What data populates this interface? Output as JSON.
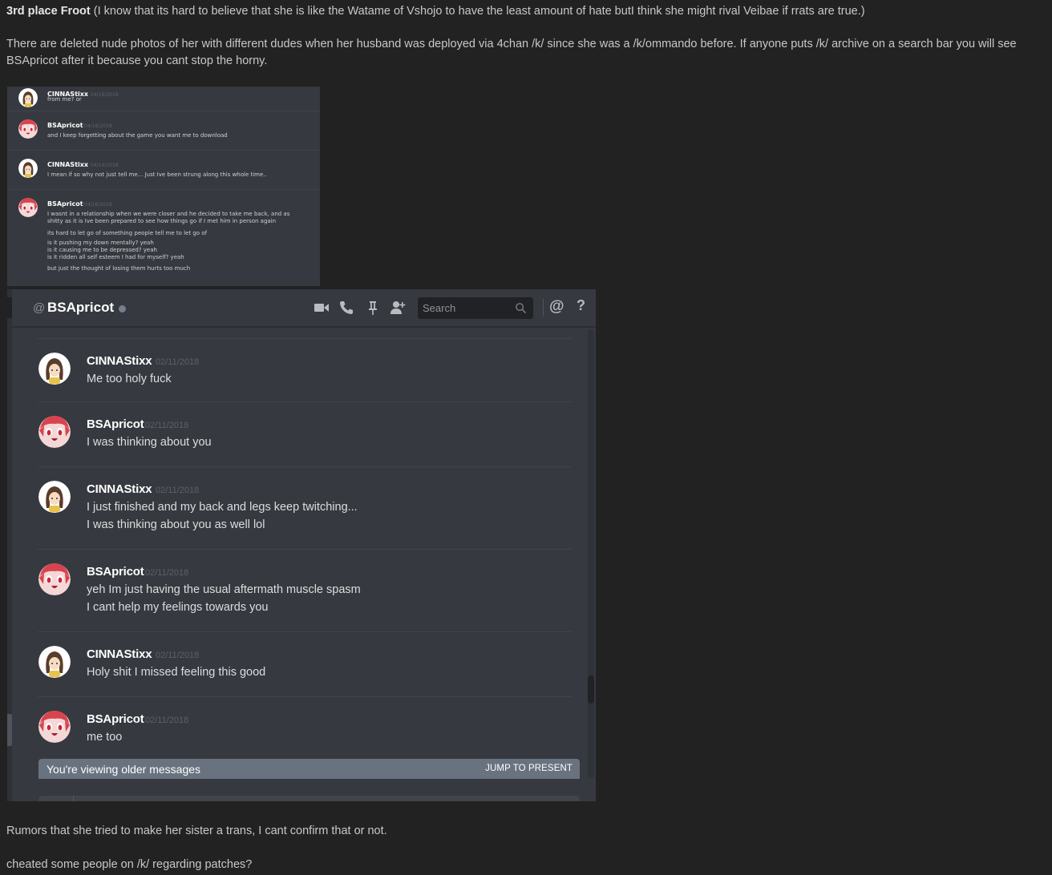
{
  "post": {
    "heading_bold": "3rd place Froot",
    "heading_rest": " (I know that its hard to believe that she is like the Watame of Vshojo to have the least amount of hate butI think she might rival Veibae if rrats are true.)",
    "para1_line1": "There are deleted nude photos of her with different dudes when her husband was deployed via 4chan /k/ since she was a /k/ommando before. If anyone puts /k/ archive on a search bar you will see",
    "para1_line2": "BSApricot after it because you cant stop the horny.",
    "para2": "Rumors that she tried to make her sister a trans, I cant confirm that or not.",
    "para3": "cheated some people on /k/ regarding patches?"
  },
  "small_chat": {
    "messages": [
      {
        "author": "CINNAStixx",
        "date": "04/16/2018",
        "text": "from me? or",
        "avatar": "cinna"
      },
      {
        "author": "BSApricot",
        "date": "04/16/2018",
        "text": "and I keep forgetting about the game you want me to download",
        "avatar": "apricot"
      },
      {
        "author": "CINNAStixx",
        "date": "04/16/2018",
        "text": "I mean if so why not just tell me... Just Ive been strung along this whole time..",
        "avatar": "cinna"
      },
      {
        "author": "BSApricot",
        "date": "04/16/2018",
        "text": "I wasnt in a relationship when we were closer and he decided to take me back, and as\nshitty as it is Ive been prepared to see how things go if I met him in person again",
        "avatar": "apricot"
      }
    ],
    "extra_lines": [
      "its hard to let go of something people tell me to let go of",
      "is it pushing my down mentally? yeah",
      "is it causing me to be depressed? yeah",
      "is it ridden all self esteem I had for myself? yeah",
      "but just the thought of losing them hurts too much"
    ]
  },
  "discord": {
    "header": {
      "at_symbol": "@",
      "channel_name": "BSApricot",
      "search_placeholder": "Search",
      "mention_symbol": "@",
      "help_symbol": "?"
    },
    "messages": [
      {
        "author": "CINNAStixx",
        "date": "02/11/2018",
        "lines": [
          "Me too holy fuck"
        ],
        "avatar": "cinna"
      },
      {
        "author": "BSApricot",
        "date": "02/11/2018",
        "lines": [
          "I was thinking about you"
        ],
        "avatar": "apricot"
      },
      {
        "author": "CINNAStixx",
        "date": "02/11/2018",
        "lines": [
          "I just finished and my back and legs keep twitching...",
          "I was thinking about you as well lol"
        ],
        "avatar": "cinna"
      },
      {
        "author": "BSApricot",
        "date": "02/11/2018",
        "lines": [
          "yeh Im just having the usual aftermath muscle spasm",
          "I cant help my feelings towards you"
        ],
        "avatar": "apricot"
      },
      {
        "author": "CINNAStixx",
        "date": "02/11/2018",
        "lines": [
          "Holy shit I missed feeling this good"
        ],
        "avatar": "cinna"
      },
      {
        "author": "BSApricot",
        "date": "02/11/2018",
        "lines": [
          "me too"
        ],
        "avatar": "apricot"
      }
    ],
    "older_notice": "You're viewing older messages",
    "jump_label": "JUMP TO PRESENT"
  },
  "colors": {
    "page_bg": "#222222",
    "discord_bg": "#36393f",
    "older_bar": "#697380",
    "status_offline": "#747f8d"
  }
}
